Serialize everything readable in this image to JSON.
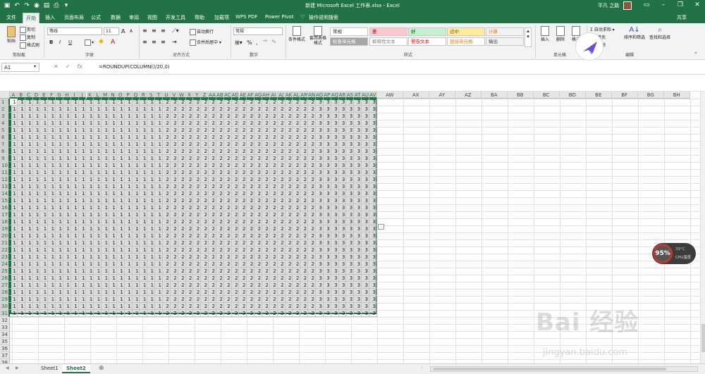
{
  "window": {
    "title": "新建 Microsoft Excel 工作表.xlsx - Excel",
    "user": "平凡 之路",
    "share": "共享"
  },
  "tabs": [
    "文件",
    "开始",
    "插入",
    "页面布局",
    "公式",
    "数据",
    "审阅",
    "视图",
    "开发工具",
    "帮助",
    "加载项",
    "WPS PDF",
    "Power Pivot",
    "操作说明搜索"
  ],
  "ribbon": {
    "clipboard": {
      "paste": "粘贴",
      "cut": "剪切",
      "copy": "复制",
      "painter": "格式刷",
      "label": "剪贴板"
    },
    "font": {
      "name": "等线",
      "size": "11",
      "label": "字体",
      "bold": "B",
      "italic": "I",
      "underline": "U",
      "grow": "A",
      "shrink": "A"
    },
    "align": {
      "wrap": "自动换行",
      "merge": "合并后居中",
      "label": "对齐方式"
    },
    "number": {
      "format": "常规",
      "label": "数字",
      "pct": "%",
      "comma": ","
    },
    "styles": {
      "cond": "条件格式",
      "table": "套用表格格式",
      "label": "样式",
      "cells": [
        {
          "text": "常规",
          "bg": "#ffffff",
          "fg": "#222222"
        },
        {
          "text": "差",
          "bg": "#ffc7ce",
          "fg": "#9c0006"
        },
        {
          "text": "好",
          "bg": "#c6efce",
          "fg": "#006100"
        },
        {
          "text": "适中",
          "bg": "#ffeb9c",
          "fg": "#9c5700"
        },
        {
          "text": "计算",
          "bg": "#f2f2f2",
          "fg": "#fa7d00"
        },
        {
          "text": "检查单元格",
          "bg": "#a5a5a5",
          "fg": "#ffffff"
        },
        {
          "text": "解释性文本",
          "bg": "#ffffff",
          "fg": "#7f7f7f"
        },
        {
          "text": "警告文本",
          "bg": "#ffffff",
          "fg": "#ff0000"
        },
        {
          "text": "链接单元格",
          "bg": "#ffffff",
          "fg": "#fa7d00"
        },
        {
          "text": "输出",
          "bg": "#f2f2f2",
          "fg": "#3f3f3f"
        }
      ]
    },
    "cells": {
      "insert": "插入",
      "delete": "删除",
      "format": "格式",
      "label": "单元格"
    },
    "edit": {
      "autosum": "自动求和",
      "fill": "填充",
      "clear": "清除",
      "sort": "排序和筛选",
      "find": "查找和选择",
      "label": "编辑"
    }
  },
  "formula_bar": {
    "namebox": "A1",
    "fx": "fx",
    "formula": "=ROUNDUP(COLUMN()/20,0)"
  },
  "grid": {
    "narrow_columns": [
      "A",
      "B",
      "C",
      "D",
      "E",
      "F",
      "G",
      "H",
      "I",
      "J",
      "K",
      "L",
      "M",
      "N",
      "O",
      "P",
      "Q",
      "R",
      "S",
      "T",
      "U",
      "V",
      "W",
      "X",
      "Y",
      "Z",
      "AA",
      "AB",
      "AC",
      "AD",
      "AE",
      "AF",
      "AG",
      "AH",
      "AI",
      "AJ",
      "AK",
      "AL",
      "AM",
      "AN",
      "AO",
      "AP",
      "AQ",
      "AR",
      "AS",
      "AT",
      "AU",
      "AV"
    ],
    "wide_columns": [
      "AW",
      "AX",
      "AY",
      "AZ",
      "BA",
      "BB",
      "BC",
      "BD",
      "BE",
      "BF",
      "BG",
      "BH"
    ],
    "row_values": [
      "1",
      "1",
      "1",
      "1",
      "1",
      "1",
      "1",
      "1",
      "1",
      "1",
      "1",
      "1",
      "1",
      "1",
      "1",
      "1",
      "1",
      "1",
      "1",
      "1",
      "2",
      "2",
      "2",
      "2",
      "2",
      "2",
      "2",
      "2",
      "2",
      "2",
      "2",
      "2",
      "2",
      "2",
      "2",
      "2",
      "2",
      "2",
      "2",
      "2",
      "3",
      "3",
      "3",
      "3",
      "3",
      "3",
      "3",
      "3"
    ],
    "filled_rows": 31,
    "total_rows": 38
  },
  "sheets": [
    "Sheet1",
    "Sheet2"
  ],
  "active_sheet": "Sheet2",
  "overlay": {
    "cpu_percent": "95%",
    "cpu_temp": "39°C",
    "cpu_label": "CPU温度"
  },
  "watermark": {
    "brand": "Bai 经验",
    "url": "jingyan.baidu.com"
  }
}
